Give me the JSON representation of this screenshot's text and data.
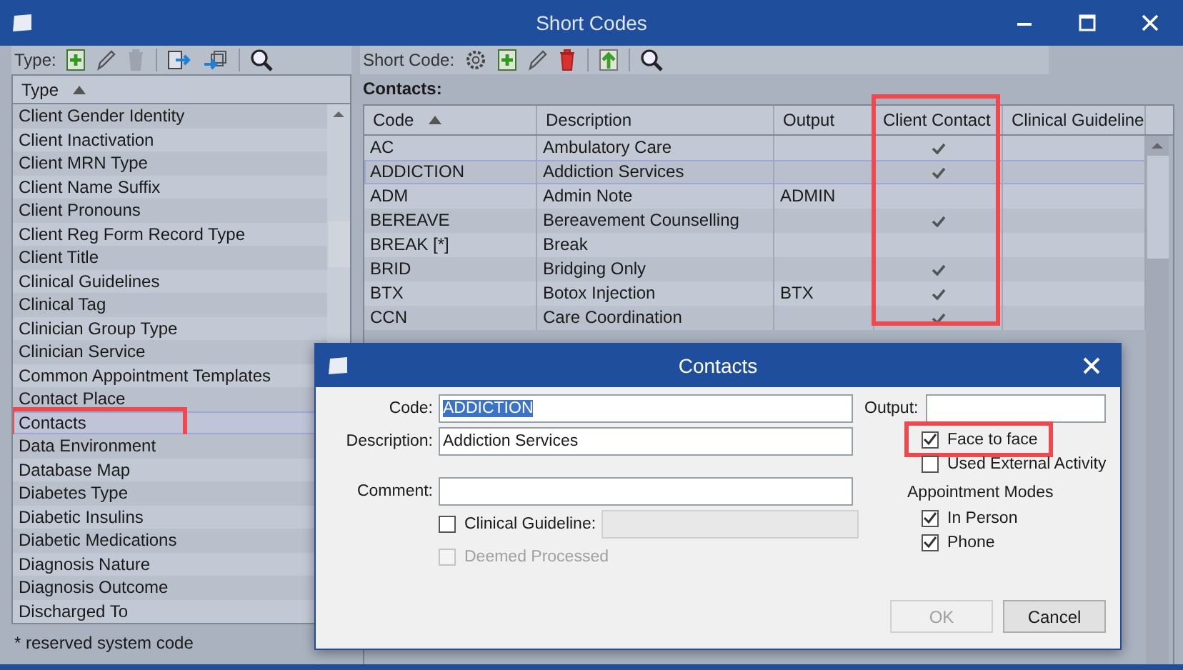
{
  "window": {
    "title": "Short Codes"
  },
  "type_toolbar": {
    "label": "Type:"
  },
  "type_list": {
    "column": "Type",
    "items": [
      {
        "label": "Client Gender Identity",
        "selected": false,
        "highlighted": false
      },
      {
        "label": "Client Inactivation",
        "selected": false,
        "highlighted": false
      },
      {
        "label": "Client MRN Type",
        "selected": false,
        "highlighted": false
      },
      {
        "label": "Client Name Suffix",
        "selected": false,
        "highlighted": false
      },
      {
        "label": "Client Pronouns",
        "selected": false,
        "highlighted": false
      },
      {
        "label": "Client Reg Form Record Type",
        "selected": false,
        "highlighted": false
      },
      {
        "label": "Client Title",
        "selected": false,
        "highlighted": false
      },
      {
        "label": "Clinical Guidelines",
        "selected": false,
        "highlighted": false
      },
      {
        "label": "Clinical Tag",
        "selected": false,
        "highlighted": false
      },
      {
        "label": "Clinician Group Type",
        "selected": false,
        "highlighted": false
      },
      {
        "label": "Clinician Service",
        "selected": false,
        "highlighted": false
      },
      {
        "label": "Common Appointment Templates",
        "selected": false,
        "highlighted": false
      },
      {
        "label": "Contact Place",
        "selected": false,
        "highlighted": false
      },
      {
        "label": "Contacts",
        "selected": true,
        "highlighted": true
      },
      {
        "label": "Data Environment",
        "selected": false,
        "highlighted": false
      },
      {
        "label": "Database Map",
        "selected": false,
        "highlighted": false
      },
      {
        "label": "Diabetes Type",
        "selected": false,
        "highlighted": false
      },
      {
        "label": "Diabetic Insulins",
        "selected": false,
        "highlighted": false
      },
      {
        "label": "Diabetic Medications",
        "selected": false,
        "highlighted": false
      },
      {
        "label": "Diagnosis Nature",
        "selected": false,
        "highlighted": false
      },
      {
        "label": "Diagnosis Outcome",
        "selected": false,
        "highlighted": false
      },
      {
        "label": "Discharged To",
        "selected": false,
        "highlighted": false
      }
    ]
  },
  "footnote": "* reserved system code",
  "short_code_toolbar": {
    "label": "Short Code:"
  },
  "contacts": {
    "title": "Contacts:",
    "columns": [
      {
        "label": "Code",
        "highlighted": false
      },
      {
        "label": "Description",
        "highlighted": false
      },
      {
        "label": "Output",
        "highlighted": false
      },
      {
        "label": "Client Contact",
        "highlighted": true
      },
      {
        "label": "Clinical Guideline",
        "highlighted": false
      }
    ],
    "rows": [
      {
        "code": "AC",
        "description": "Ambulatory Care",
        "output": "",
        "client_contact": true,
        "selected": false
      },
      {
        "code": "ADDICTION",
        "description": "Addiction Services",
        "output": "",
        "client_contact": true,
        "selected": true
      },
      {
        "code": "ADM",
        "description": "Admin Note",
        "output": "ADMIN",
        "client_contact": false,
        "selected": false
      },
      {
        "code": "BEREAVE",
        "description": "Bereavement Counselling",
        "output": "",
        "client_contact": true,
        "selected": false
      },
      {
        "code": "BREAK [*]",
        "description": "Break",
        "output": "",
        "client_contact": false,
        "selected": false
      },
      {
        "code": "BRID",
        "description": "Bridging Only",
        "output": "",
        "client_contact": true,
        "selected": false
      },
      {
        "code": "BTX",
        "description": "Botox Injection",
        "output": "BTX",
        "client_contact": true,
        "selected": false
      },
      {
        "code": "CCN",
        "description": "Care Coordination",
        "output": "",
        "client_contact": true,
        "selected": false
      }
    ]
  },
  "dialog": {
    "title": "Contacts",
    "code": {
      "label": "Code:",
      "value": "ADDICTION",
      "text_selected": true
    },
    "description": {
      "label": "Description:",
      "value": "Addiction Services"
    },
    "comment": {
      "label": "Comment:"
    },
    "clinical_guideline": {
      "label": "Clinical Guideline:",
      "checked": false
    },
    "deemed_processed": {
      "label": "Deemed Processed",
      "checked": false,
      "disabled": true
    },
    "output": {
      "label": "Output:"
    },
    "options": [
      {
        "label": "Face to face",
        "checked": true,
        "highlighted": true
      },
      {
        "label": "Used External Activity",
        "checked": false,
        "highlighted": false
      }
    ],
    "appointment_modes": {
      "title": "Appointment Modes",
      "items": [
        {
          "label": "In Person",
          "checked": true
        },
        {
          "label": "Phone",
          "checked": true
        }
      ]
    },
    "buttons": [
      {
        "label": "OK",
        "disabled": true
      },
      {
        "label": "Cancel",
        "disabled": false
      }
    ]
  }
}
